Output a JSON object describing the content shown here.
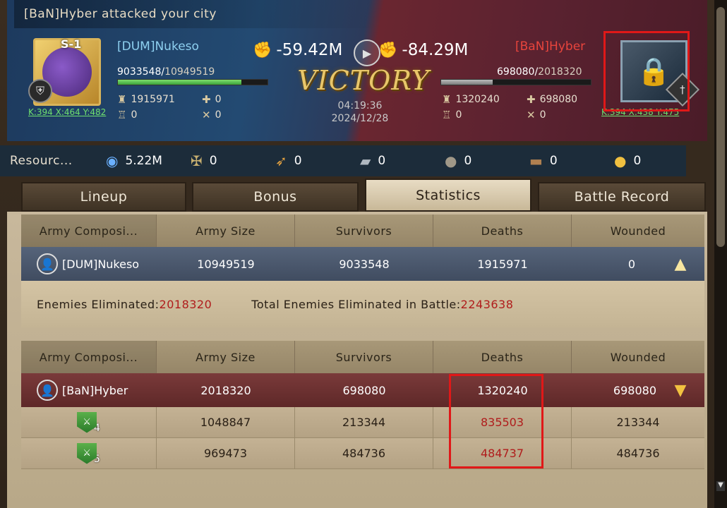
{
  "header": {
    "title": "[BaN]Hyber attacked your city",
    "result": "VICTORY",
    "time": "04:19:36",
    "date": "2024/12/28"
  },
  "attacker_side": {
    "level_badge": "S-1",
    "name": "[DUM]Nukeso",
    "troops_current": "9033548",
    "troops_max": "10949519",
    "troops_fraction": 0.825,
    "coords": "K:394 X:464 Y:482",
    "deaths": "1915971",
    "heal": "0",
    "tower": "0",
    "wounded": "0",
    "power_change": "-59.42M"
  },
  "defender_side": {
    "name": "[BaN]Hyber",
    "troops_current": "698080",
    "troops_max": "2018320",
    "troops_fraction": 0.346,
    "coords": "K:394 X:438 Y:475",
    "deaths": "1320240",
    "heal": "698080",
    "tower": "0",
    "wounded": "0",
    "power_change": "-84.29M"
  },
  "resources": {
    "label": "Resourc...",
    "items": [
      {
        "icon": "exp-icon",
        "value": "5.22M"
      },
      {
        "icon": "medal-icon",
        "value": "0"
      },
      {
        "icon": "feather-icon",
        "value": "0"
      },
      {
        "icon": "iron-ingot-icon",
        "value": "0"
      },
      {
        "icon": "stone-icon",
        "value": "0"
      },
      {
        "icon": "wood-icon",
        "value": "0"
      },
      {
        "icon": "gold-coin-icon",
        "value": "0"
      }
    ]
  },
  "tabs": [
    "Lineup",
    "Bonus",
    "Statistics",
    "Battle Record"
  ],
  "active_tab": "Statistics",
  "columns": [
    "Army Composi...",
    "Army Size",
    "Survivors",
    "Deaths",
    "Wounded"
  ],
  "table1": {
    "player": "[DUM]Nukeso",
    "army_size": "10949519",
    "survivors": "9033548",
    "deaths": "1915971",
    "wounded": "0",
    "enemies_label": "Enemies Eliminated:",
    "enemies_value": "2018320",
    "total_label": "Total Enemies Eliminated in Battle:",
    "total_value": "2243638"
  },
  "table2": {
    "player": "[BaN]Hyber",
    "army_size": "2018320",
    "survivors": "698080",
    "deaths": "1320240",
    "wounded": "698080",
    "units": [
      {
        "tier": "4",
        "army_size": "1048847",
        "survivors": "213344",
        "deaths": "835503",
        "wounded": "213344"
      },
      {
        "tier": "5",
        "army_size": "969473",
        "survivors": "484736",
        "deaths": "484737",
        "wounded": "484736"
      }
    ]
  },
  "colors": {
    "highlight_box": "#e01818",
    "death_red": "#b01c1c",
    "coord_green": "#6fe06f",
    "attacker_name": "#8ed0f0",
    "defender_name": "#e8443c"
  }
}
